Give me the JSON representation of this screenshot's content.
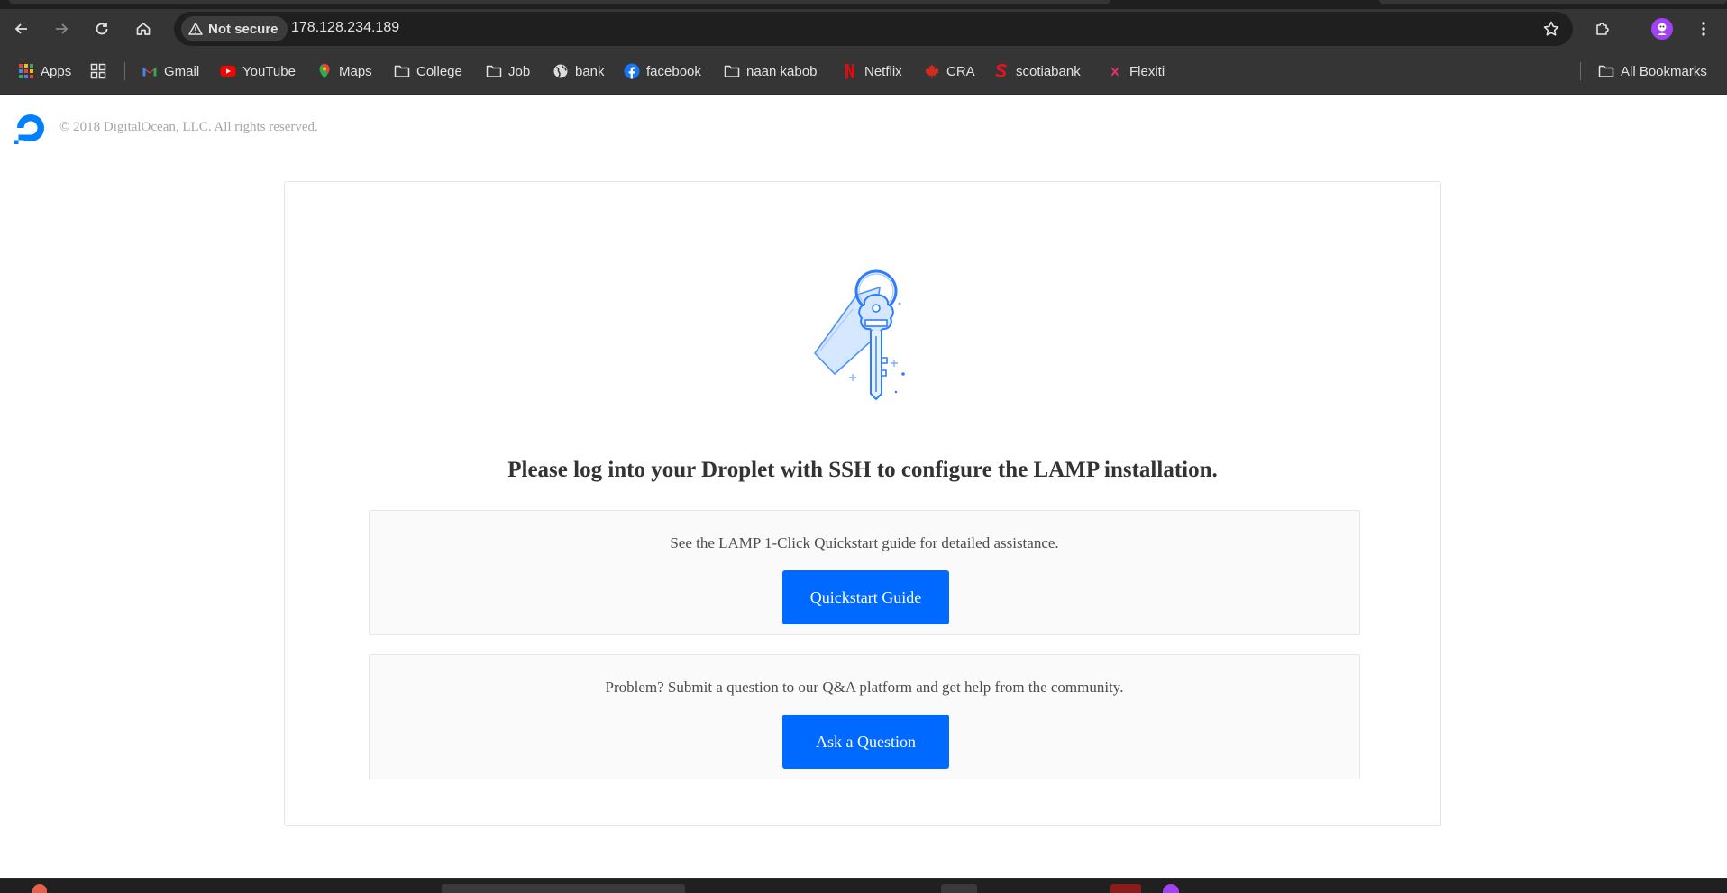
{
  "browser": {
    "security_label": "Not secure",
    "url": "178.128.234.189",
    "bookmarks": [
      {
        "label": "Apps",
        "icon": "apps-grid-icon"
      },
      {
        "label": "",
        "icon": "tab-groups-icon"
      },
      {
        "label": "Gmail",
        "icon": "gmail-icon"
      },
      {
        "label": "YouTube",
        "icon": "youtube-icon"
      },
      {
        "label": "Maps",
        "icon": "maps-icon"
      },
      {
        "label": "College",
        "icon": "folder-icon"
      },
      {
        "label": "Job",
        "icon": "folder-icon"
      },
      {
        "label": "bank",
        "icon": "globe-icon"
      },
      {
        "label": "facebook",
        "icon": "facebook-icon"
      },
      {
        "label": "naan kabob",
        "icon": "folder-icon"
      },
      {
        "label": "Netflix",
        "icon": "netflix-icon"
      },
      {
        "label": "CRA",
        "icon": "maple-leaf-icon"
      },
      {
        "label": "scotiabank",
        "icon": "scotiabank-icon"
      },
      {
        "label": "Flexiti",
        "icon": "flexiti-icon"
      }
    ],
    "all_bookmarks_label": "All Bookmarks"
  },
  "page": {
    "copyright": "© 2018 DigitalOcean, LLC. All rights reserved.",
    "headline": "Please log into your Droplet with SSH to configure the LAMP installation.",
    "panels": [
      {
        "text": "See the LAMP 1-Click Quickstart guide for detailed assistance.",
        "button": "Quickstart Guide"
      },
      {
        "text": "Problem? Submit a question to our Q&A platform and get help from the community.",
        "button": "Ask a Question"
      }
    ]
  },
  "colors": {
    "accent": "#0069ff",
    "chrome_bg": "#353535",
    "omnibox_bg": "#1f1f1f",
    "profile": "#a142f4"
  }
}
